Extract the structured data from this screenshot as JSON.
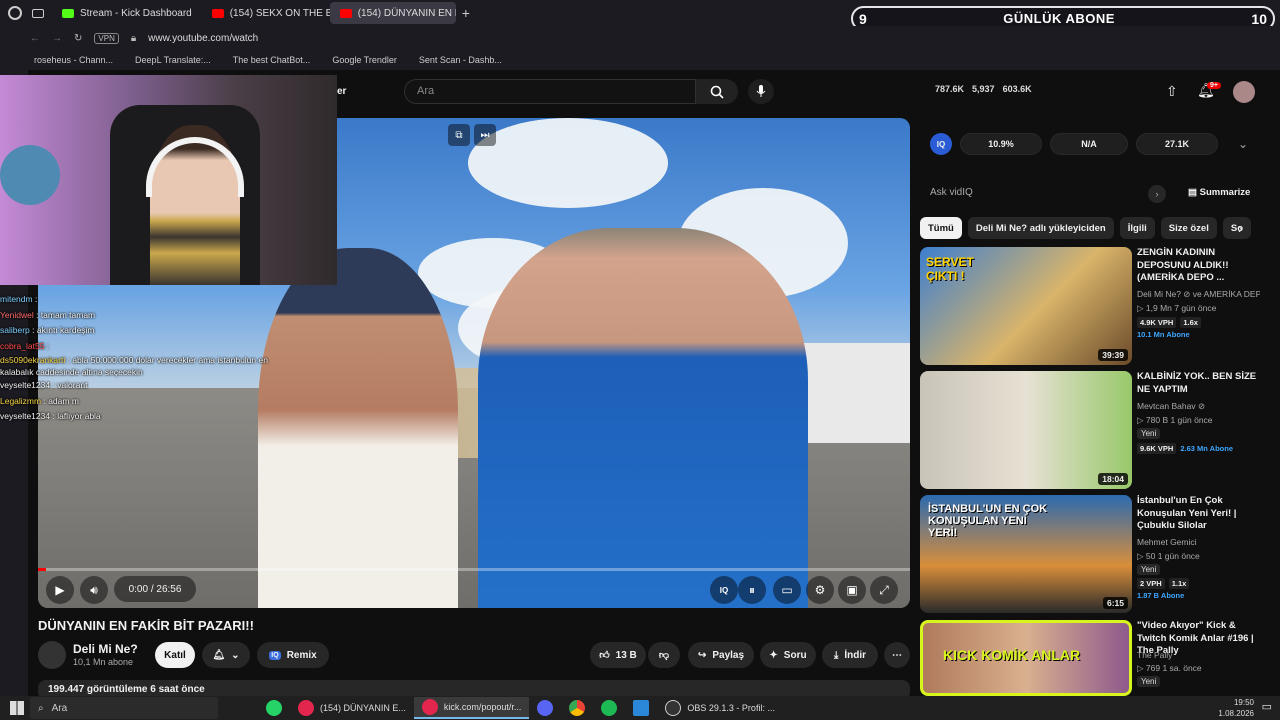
{
  "browser": {
    "tabs": [
      {
        "label": "Stream - Kick Dashboard",
        "color": "#53fc18"
      },
      {
        "label": "(154) SEKX ON THE BİÇ |",
        "color": "#ff0000"
      },
      {
        "label": "(154) DÜNYANIN EN FAKİR",
        "color": "#ff0000",
        "active": true
      }
    ],
    "url": "www.youtube.com/watch",
    "vpn_label": "VPN",
    "bookmarks": [
      "roseheus - Chann...",
      "DeepL Translate:...",
      "The best ChatBot...",
      "Google Trendler",
      "Sent Scan - Dashb..."
    ]
  },
  "overlay": {
    "sub_goal_left": "9",
    "sub_goal_label": "GÜNLÜK ABONE",
    "sub_goal_right": "10",
    "chat": [
      {
        "user": "mitendm",
        "msg": ":",
        "color": "#7fd0ff"
      },
      {
        "user": "Yenidwel",
        "msg": ": tamam tamam",
        "color": "#ff6b6b"
      },
      {
        "user": "saliberp",
        "msg": ": akıntı kardeşim",
        "color": "#7fd0ff"
      },
      {
        "user": "cobra_lat55",
        "msg": ":",
        "color": "#ff4d4d"
      },
      {
        "user": "ds5090ekrankarti",
        "msg": ": abla 50.000.000 dolar verecekler ama istanbulun en kalabalık caddesinde altına seçecekin",
        "color": "#f5d442"
      },
      {
        "user": "veyselte1234",
        "msg": ": valorant",
        "color": "#ffffff"
      },
      {
        "user": "Legalizmm",
        "msg": ": adam m",
        "color": "#f5d442"
      },
      {
        "user": "veyselte1234",
        "msg": ": laflıyor abla",
        "color": "#ffffff"
      }
    ]
  },
  "youtube": {
    "search_placeholder": "Ara",
    "partial_text": "er",
    "stats": {
      "a": "787.6K",
      "b": "5,937",
      "c": "603.6K"
    },
    "notif_count": "9+",
    "player": {
      "time": "0:00 / 26:56",
      "progress_fraction": 0.0,
      "iq_label": "IQ"
    },
    "video_title": "DÜNYANIN EN FAKİR BİT PAZARI!!",
    "channel": {
      "name": "Deli Mi Ne?",
      "subs": "10,1 Mn abone"
    },
    "join_label": "Katıl",
    "remix_label": "Remix",
    "like_count": "13 B",
    "share_label": "Paylaş",
    "ask_label": "Soru",
    "download_label": "İndir",
    "description": "199.447 görüntüleme  6 saat önce",
    "vidiq": {
      "logo": "IQ",
      "v1": "10.9%",
      "v2": "N/A",
      "v3": "27.1K",
      "ask_placeholder": "Ask vidIQ",
      "summarize": "Summarize"
    },
    "chips": [
      "Tümü",
      "Deli Mi Ne? adlı yükleyiciden",
      "İlgili",
      "Size özel",
      "So"
    ],
    "recommendations": [
      {
        "title": "ZENGİN KADININ DEPOSUNU ALDIK!! (AMERİKA DEPO ...",
        "channel": "Deli Mi Ne? ⊘ ve AMERİKA DEP...",
        "meta": "▷ 1,9 Mn  7 gün önce",
        "vph": "4.9K VPH",
        "mult": "1.6x",
        "subs": "10.1 Mn Abone",
        "duration": "39:39",
        "badge": "",
        "thumb_text": "SERVET ÇIKTI !"
      },
      {
        "title": "KALBİNİZ YOK.. BEN SİZE NE YAPTIM",
        "channel": "Mevtcan Bahav ⊘",
        "meta": "▷ 780 B  1 gün önce",
        "vph": "9.6K VPH",
        "mult": "",
        "subs": "2.63 Mn Abone",
        "duration": "18:04",
        "badge": "Yeni",
        "thumb_text": ""
      },
      {
        "title": "İstanbul'un En Çok Konuşulan Yeni Yeri! | Çubuklu Silolar",
        "channel": "Mehmet Gemici",
        "meta": "▷ 50  1 gün önce",
        "vph": "2 VPH",
        "mult": "1.1x",
        "subs": "1.87 B Abone",
        "duration": "6:15",
        "badge": "Yeni",
        "thumb_text": "İSTANBUL'UN EN ÇOK KONUŞULAN YENİ YERİ!"
      },
      {
        "title": "\"Video Akıyor\" Kick & Twitch Komik Anlar #196 | The Pally",
        "channel": "The Pally",
        "meta": "▷ 769  1 sa. önce",
        "vph": "",
        "mult": "",
        "subs": "",
        "duration": "",
        "badge": "Yeni",
        "thumb_text": "KICK KOMİK ANLAR"
      }
    ]
  },
  "taskbar": {
    "search": "Ara",
    "apps": [
      {
        "label": "(154) DÜNYANIN E...",
        "active": false
      },
      {
        "label": "kick.com/popout/r...",
        "active": true
      },
      {
        "label": "OBS 29.1.3 - Profil: ...",
        "active": false
      }
    ],
    "time": "19:50",
    "date": "1.08.2026"
  }
}
